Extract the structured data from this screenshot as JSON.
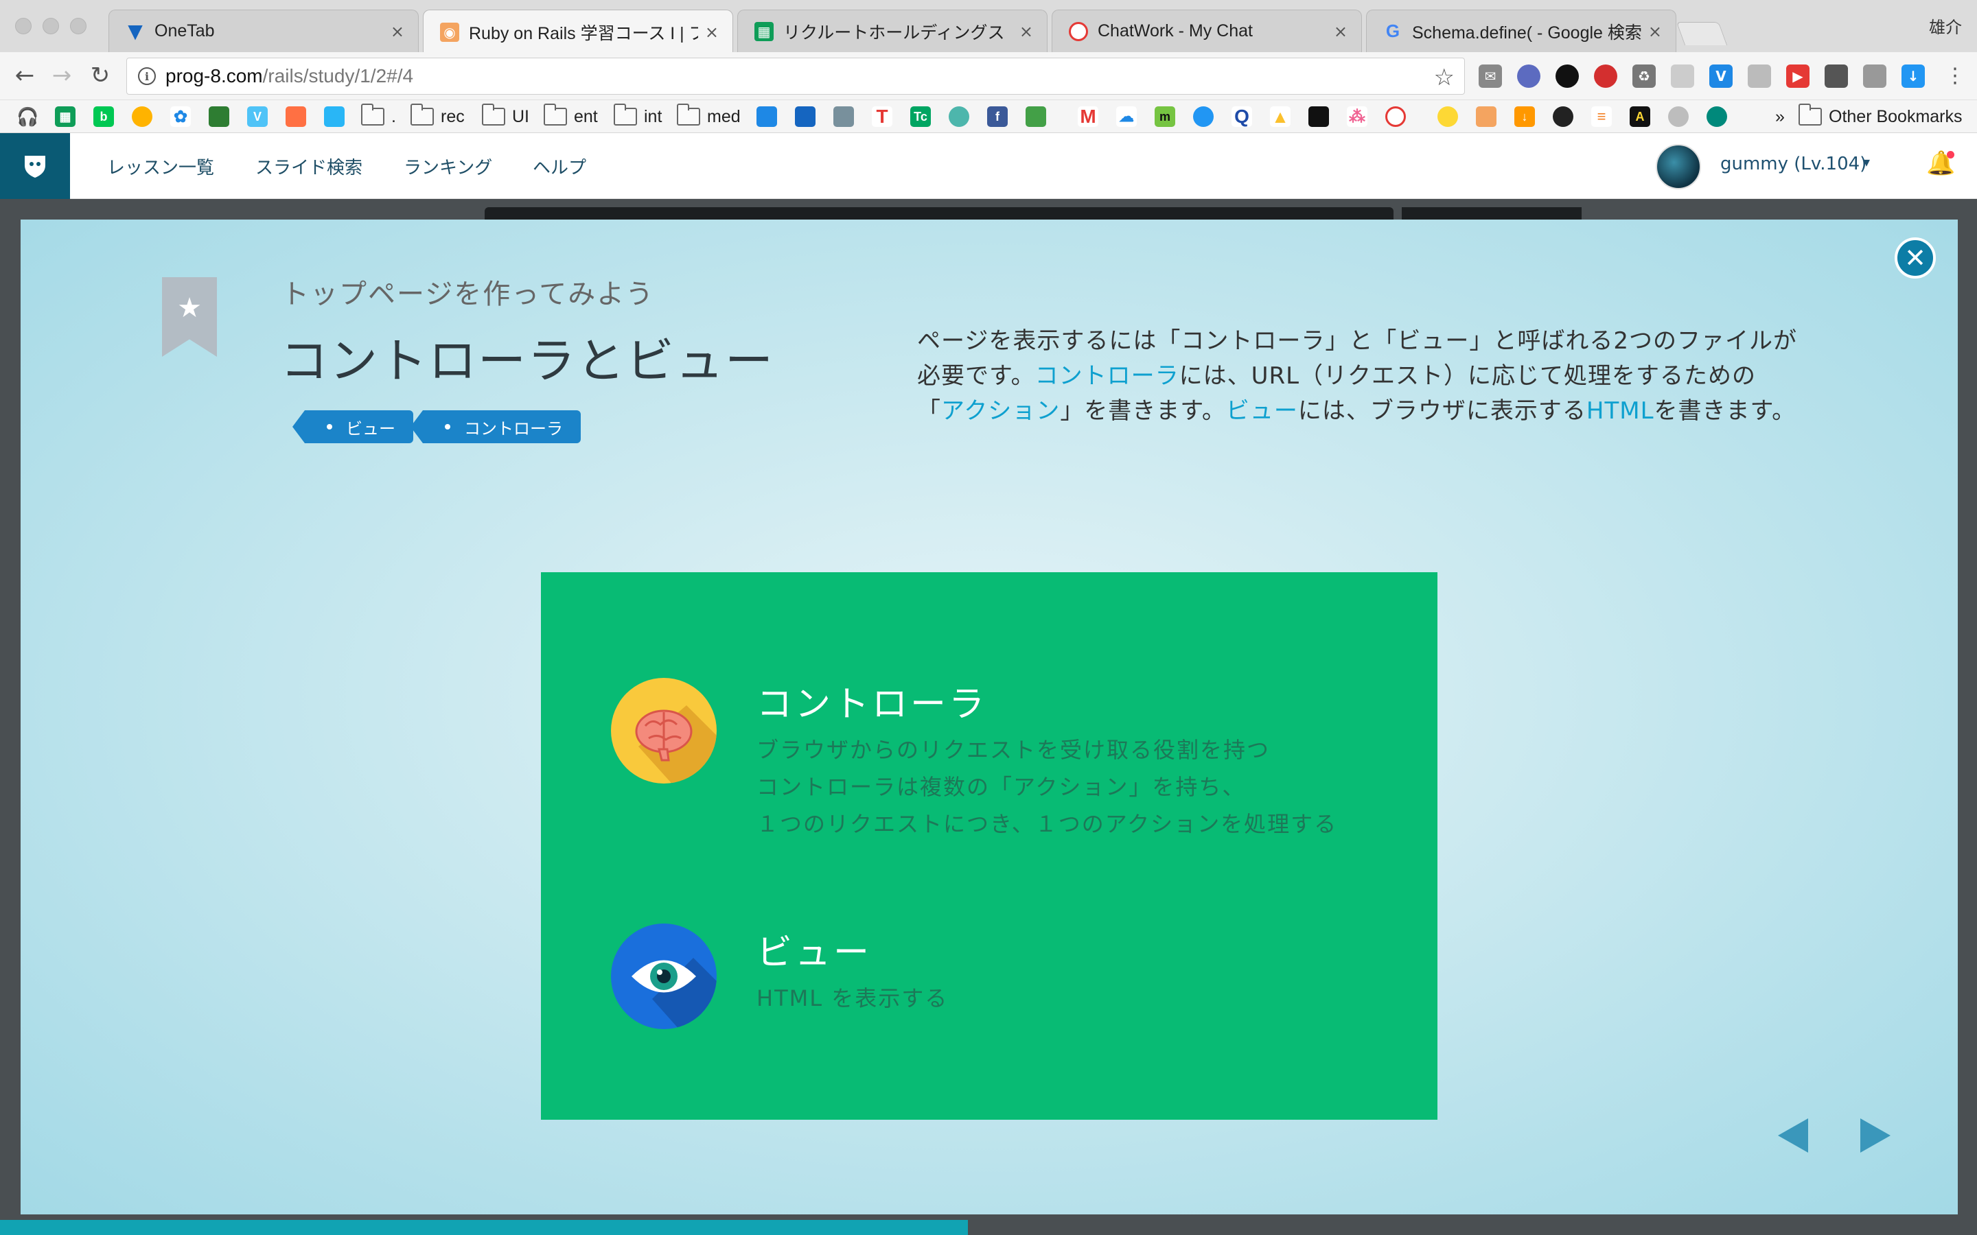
{
  "browser": {
    "tabs": [
      {
        "title": "OneTab",
        "close": "×",
        "favicon": "onetab-icon",
        "color": "#1565c0"
      },
      {
        "title": "Ruby on Rails 学習コース I | プロ",
        "close": "×",
        "favicon": "progate-icon",
        "color": "#f4a460"
      },
      {
        "title": "リクルートホールディングス　web",
        "close": "×",
        "favicon": "sheets-icon",
        "color": "#0f9d58"
      },
      {
        "title": "ChatWork - My Chat",
        "close": "×",
        "favicon": "chatwork-icon",
        "color": "#e53935"
      },
      {
        "title": "Schema.define( - Google 検索",
        "close": "×",
        "favicon": "google-icon",
        "color": "#4285f4"
      }
    ],
    "profile_name": "雄介",
    "address": {
      "host": "prog-8.com",
      "path": "/rails/study/1/2#/4",
      "info_icon": "i"
    },
    "star_icon": "☆",
    "bookmarks": [
      {
        "label": ".",
        "type": "folder"
      },
      {
        "label": "rec",
        "type": "folder"
      },
      {
        "label": "UI",
        "type": "folder"
      },
      {
        "label": "ent",
        "type": "folder"
      },
      {
        "label": "int",
        "type": "folder"
      },
      {
        "label": "med",
        "type": "folder"
      }
    ],
    "bookmark_overflow": "»",
    "other_bookmarks": "Other Bookmarks"
  },
  "site": {
    "nav": [
      "レッスン一覧",
      "スライド検索",
      "ランキング",
      "ヘルプ"
    ],
    "user_name": "gummy (Lv.104)",
    "caret": "▾",
    "bell": "🔔"
  },
  "modal": {
    "subtitle": "トップページを作ってみよう",
    "title": "コントローラとビュー",
    "tags": [
      "ビュー",
      "コントローラ"
    ],
    "close": "✕",
    "description": [
      {
        "text": "ページを表示するには「コントローラ」と「ビュー」と呼ばれる2つのファイルが必要です。"
      },
      {
        "text": "コントローラ",
        "highlight": true
      },
      {
        "text": "には、URL（リクエスト）に応じて処理をするための「"
      },
      {
        "text": "アクション",
        "highlight": true
      },
      {
        "text": "」を書きます。"
      },
      {
        "text": "ビュー",
        "highlight": true
      },
      {
        "text": "には、ブラウザに表示する"
      },
      {
        "text": "HTML",
        "highlight": true
      },
      {
        "text": "を書きます。"
      }
    ],
    "panel": {
      "color": "#08bb74",
      "controller": {
        "heading": "コントローラ",
        "lines": [
          "ブラウザからのリクエストを受け取る役割を持つ",
          "コントローラは複数の「アクション」を持ち、",
          "１つのリクエストにつき、１つのアクションを処理する"
        ],
        "icon": "brain-icon"
      },
      "view": {
        "heading": "ビュー",
        "lines": [
          "HTML を表示する"
        ],
        "icon": "eye-icon"
      }
    }
  }
}
